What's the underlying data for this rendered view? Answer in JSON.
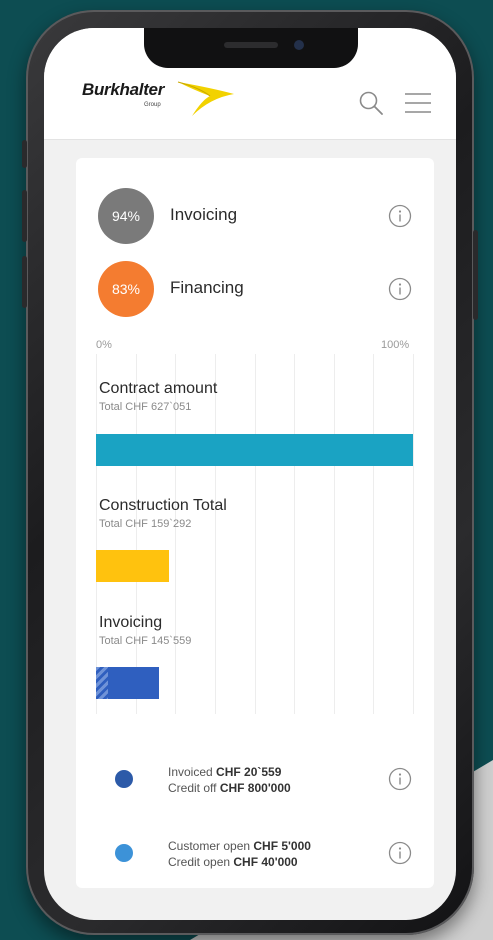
{
  "colors": {
    "background": "#0d4d52",
    "invoicing_circle": "#7a7a7a",
    "financing_circle": "#f47c30",
    "contract_bar": "#1aa3c3",
    "construction_bar": "#ffc20e",
    "invoicing_bar": "#2f5fbf",
    "legend_invoiced_dot": "#2c5aa8",
    "legend_customer_dot": "#3c92d8"
  },
  "header": {
    "logo_text": "Burkhalter",
    "logo_sub": "Group",
    "icons": [
      "search-icon",
      "menu-icon"
    ]
  },
  "stats": [
    {
      "percent": "94%",
      "label": "Invoicing",
      "icon": "info-icon"
    },
    {
      "percent": "83%",
      "label": "Financing",
      "icon": "info-icon"
    }
  ],
  "chart_data": {
    "type": "bar",
    "axis": {
      "min_label": "0%",
      "max_label": "100%",
      "min": 0,
      "max": 100
    },
    "grid": true,
    "bars": [
      {
        "title": "Contract amount",
        "subtitle": "Total CHF 627`051",
        "value": 100,
        "color": "#1aa3c3",
        "striped": false
      },
      {
        "title": "Construction Total",
        "subtitle": "Total CHF 159`292",
        "value": 23,
        "color": "#ffc20e",
        "striped": false
      },
      {
        "title": "Invoicing",
        "subtitle": "Total CHF 145`559",
        "value": 20,
        "color": "#2f5fbf",
        "striped": true
      }
    ]
  },
  "legend": [
    {
      "line1_prefix": "Invoiced",
      "line1_value": "CHF 20`559",
      "line2_prefix": "Credit off",
      "line2_value": "CHF 800'000",
      "dot_color": "#2c5aa8",
      "icon": "info-icon"
    },
    {
      "line1_prefix": "Customer open",
      "line1_value": "CHF 5'000",
      "line2_prefix": "Credit open",
      "line2_value": "CHF 40'000",
      "dot_color": "#3c92d8",
      "icon": "info-icon"
    }
  ]
}
